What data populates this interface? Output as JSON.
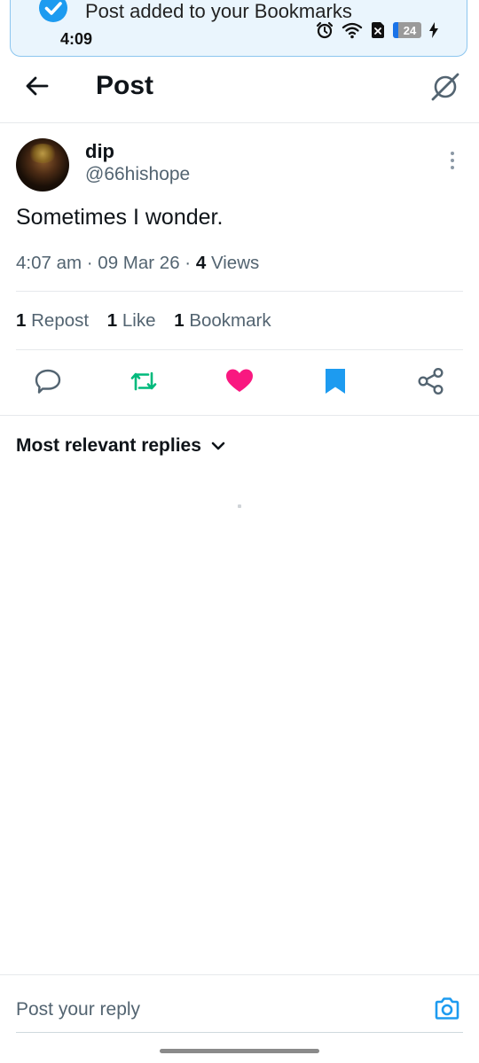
{
  "toast": {
    "message": "Post added to your Bookmarks"
  },
  "status_bar": {
    "time": "4:09",
    "battery": "24"
  },
  "header": {
    "title": "Post"
  },
  "post": {
    "author_name": "dip",
    "author_handle": "@66hishope",
    "text": "Sometimes I wonder.",
    "time": "4:07 am",
    "date": "09 Mar 26",
    "views_count": "4",
    "views_label": "Views",
    "reposts_count": "1",
    "reposts_label": "Repost",
    "likes_count": "1",
    "likes_label": "Like",
    "bookmarks_count": "1",
    "bookmarks_label": "Bookmark"
  },
  "actions": {
    "icons": [
      "reply-icon",
      "repost-icon",
      "like-icon",
      "bookmark-icon",
      "share-icon"
    ],
    "colors": {
      "repost": "#00ba7c",
      "like": "#f91880",
      "bookmark": "#1d9bf0",
      "default": "#536471"
    }
  },
  "replies": {
    "filter_label": "Most relevant replies"
  },
  "reply_bar": {
    "placeholder": "Post your reply"
  }
}
